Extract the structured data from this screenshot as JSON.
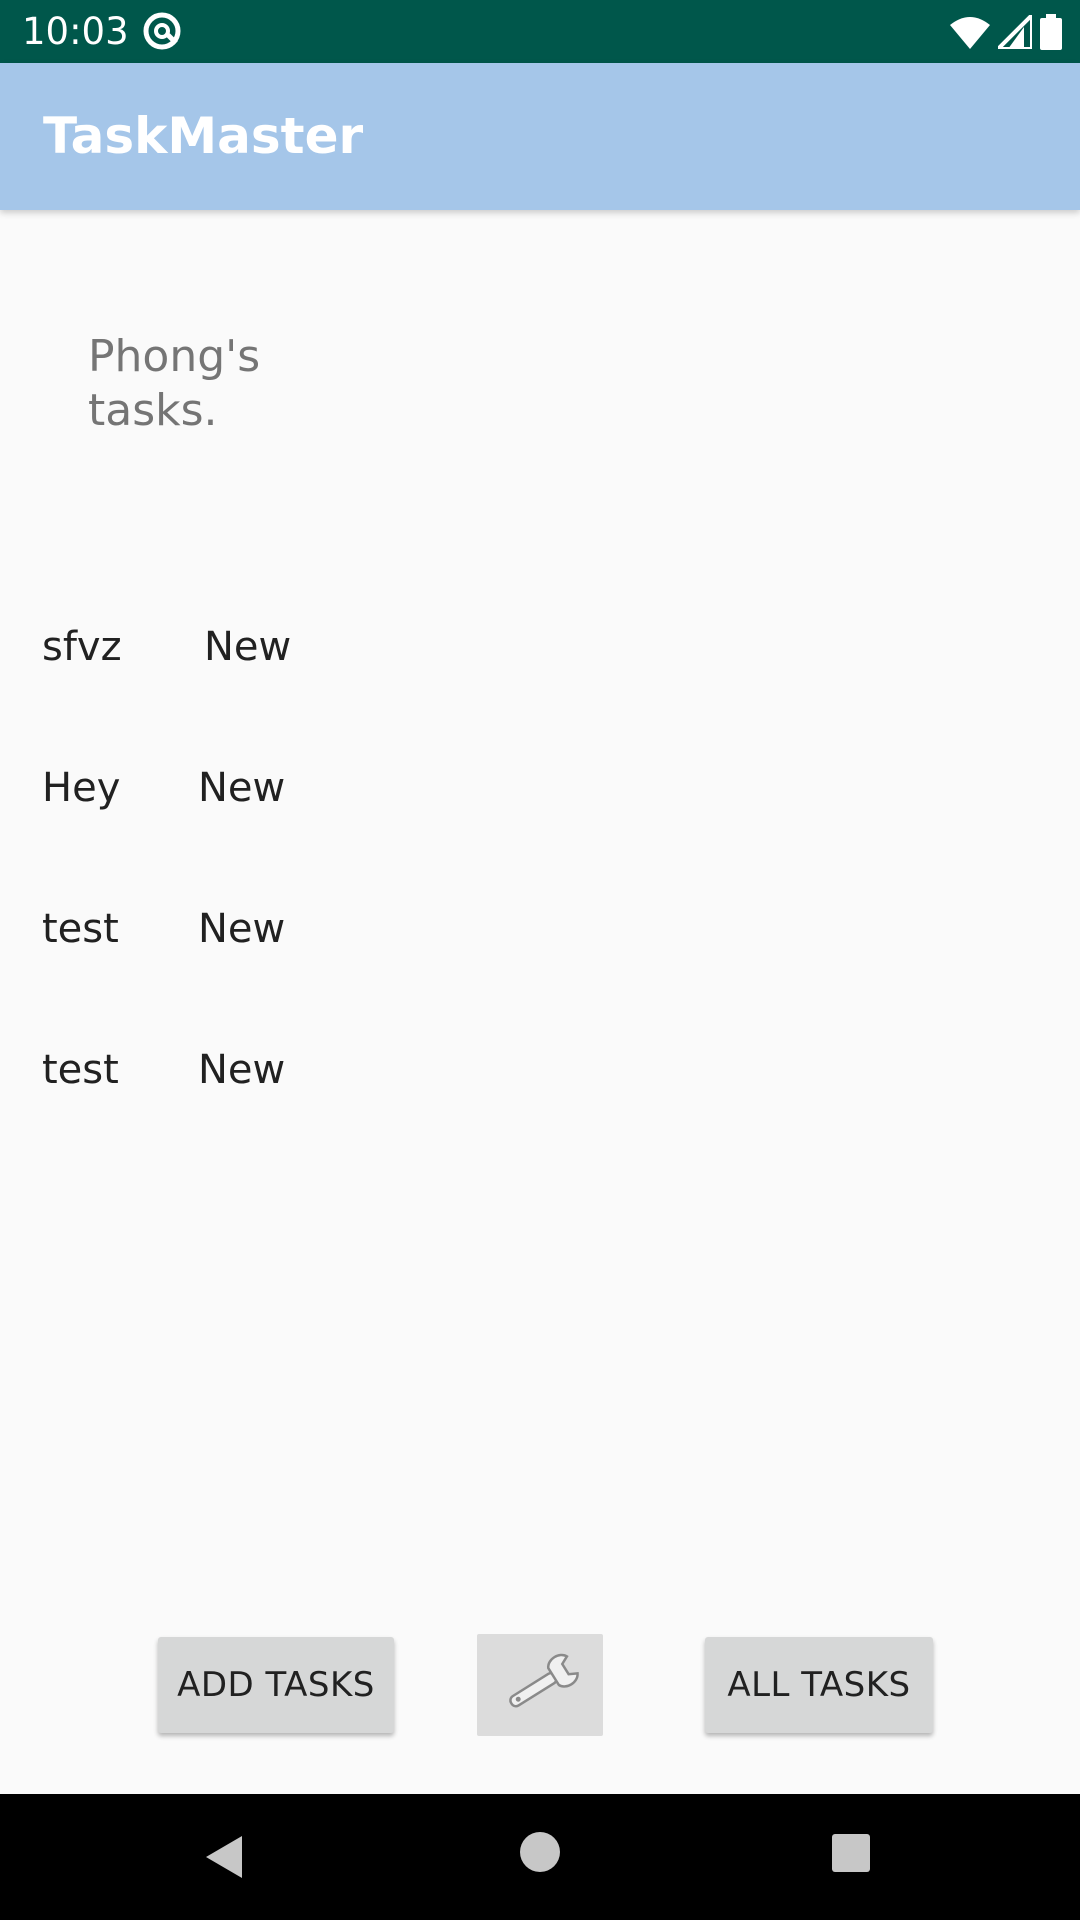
{
  "status_bar": {
    "time": "10:03",
    "icons": [
      "at-sign-icon",
      "wifi-icon",
      "signal-icon",
      "battery-icon"
    ]
  },
  "app_bar": {
    "title": "TaskMaster",
    "color": "#a5c6e9"
  },
  "heading": {
    "line1": "Phong's",
    "line2": "tasks."
  },
  "tasks": [
    {
      "title": "sfvz",
      "state": "New"
    },
    {
      "title": "Hey",
      "state": "New"
    },
    {
      "title": "test",
      "state": "New"
    },
    {
      "title": "test",
      "state": "New"
    }
  ],
  "buttons": {
    "add_tasks": "ADD TASKS",
    "settings_icon": "wrench-icon",
    "all_tasks": "ALL TASKS"
  },
  "nav_bar": {
    "icons": [
      "back-icon",
      "home-icon",
      "recents-icon"
    ]
  },
  "colors": {
    "status_bar": "#00574b",
    "background": "#fafafa",
    "button": "#d6d7d7"
  }
}
